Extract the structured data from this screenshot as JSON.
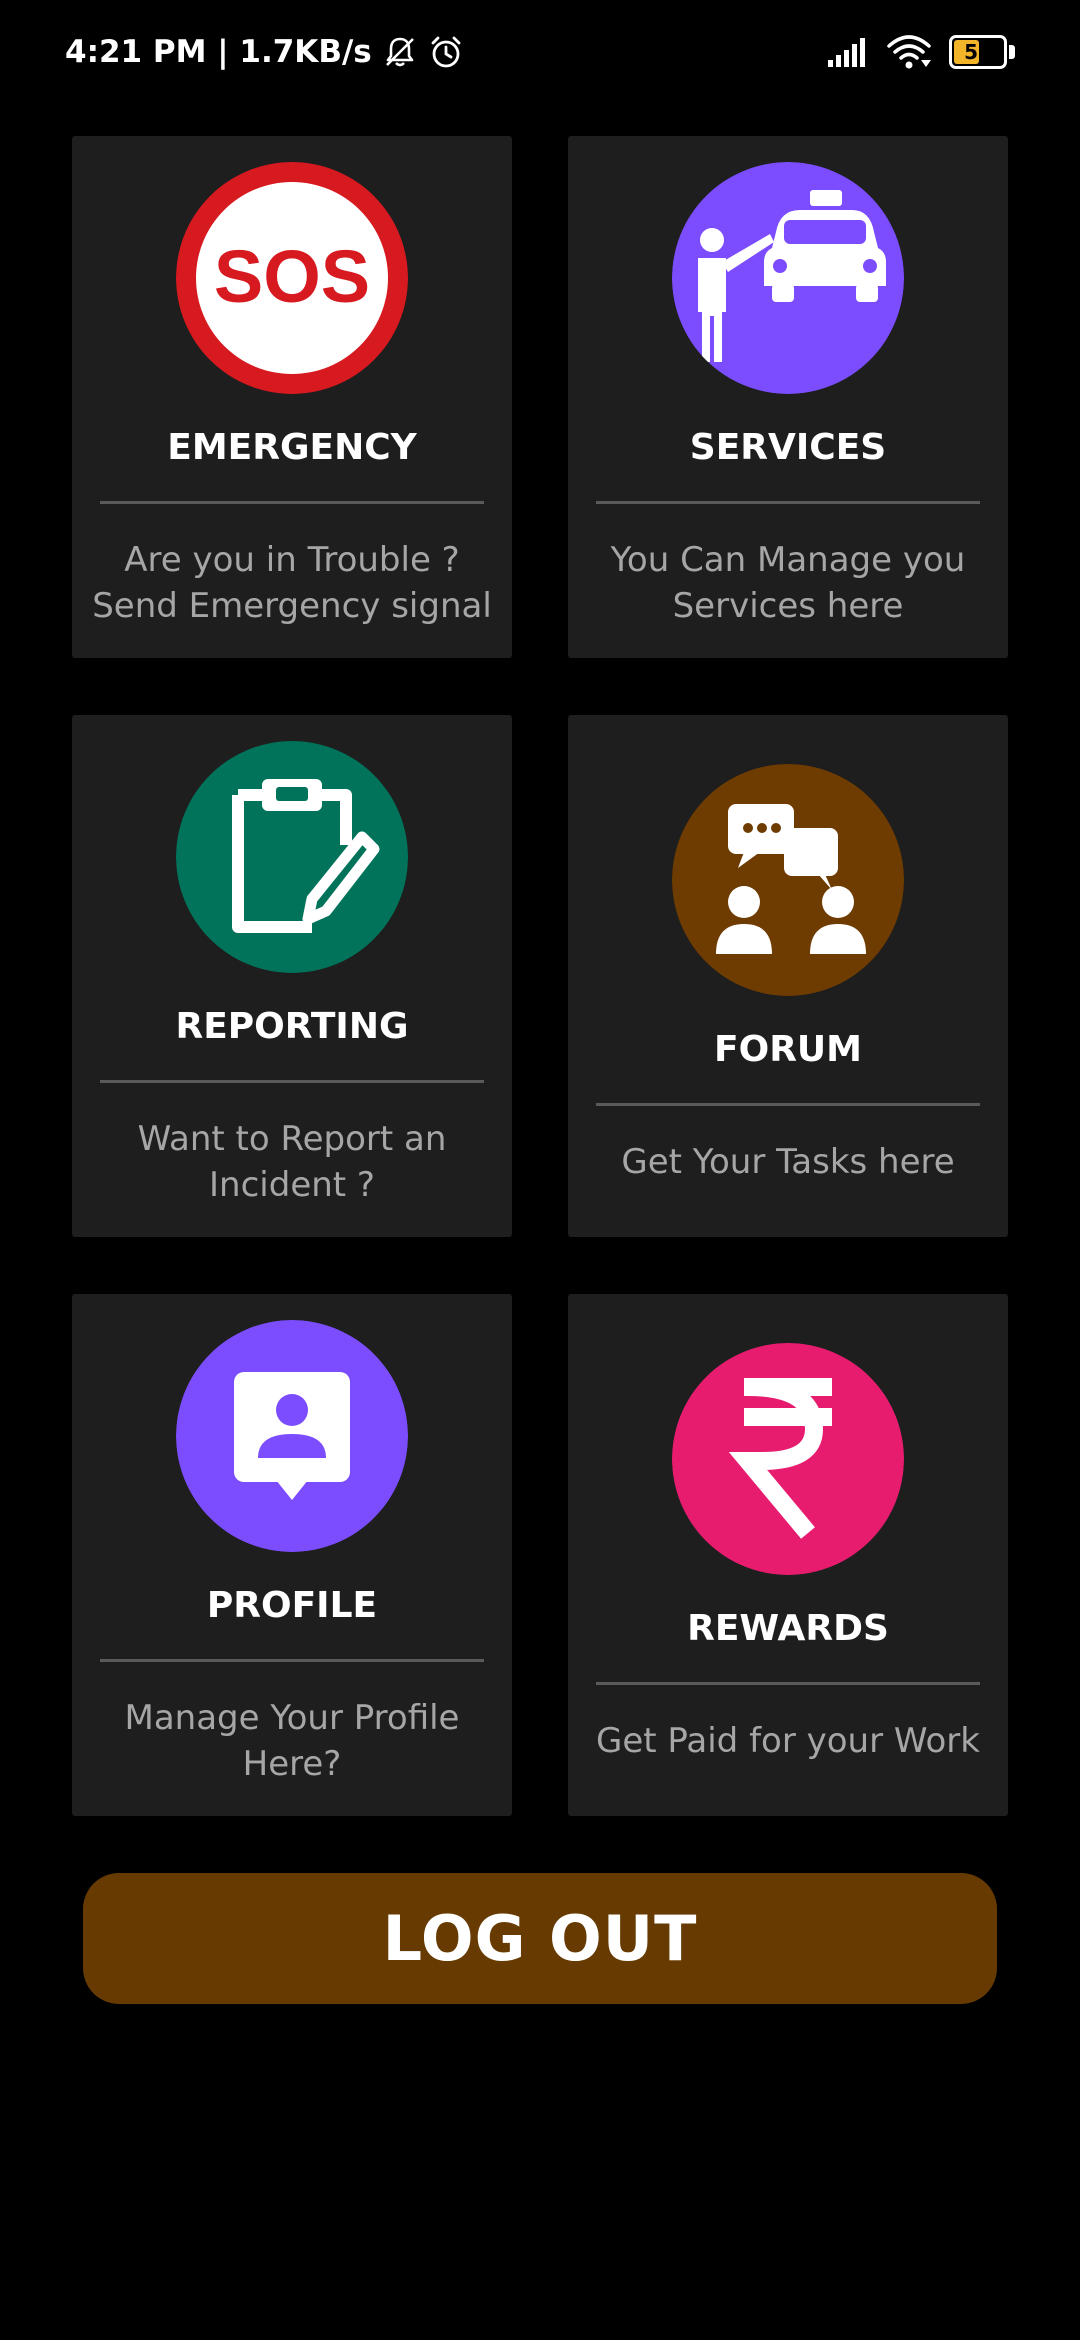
{
  "status_bar": {
    "time_speed": "4:21 PM | 1.7KB/s",
    "icons": [
      "mute-bell-icon",
      "alarm-clock-icon",
      "signal-icon",
      "wifi-icon",
      "battery-icon"
    ],
    "battery_level": "52",
    "battery_fraction": 0.52,
    "battery_color": "#f2b52a"
  },
  "cards": [
    {
      "icon": "sos-icon",
      "icon_text": "SOS",
      "icon_color": "#d71920",
      "title": "EMERGENCY",
      "desc_line1": "Are you in Trouble ?",
      "desc_line2": "Send Emergency signal"
    },
    {
      "icon": "taxi-services-icon",
      "icon_color": "#7c4dff",
      "title": "SERVICES",
      "desc_line1": "You Can Manage you",
      "desc_line2": "Services here"
    },
    {
      "icon": "clipboard-report-icon",
      "icon_color": "#00735a",
      "title": "REPORTING",
      "desc_line1": "Want to Report an",
      "desc_line2": "Incident ?"
    },
    {
      "icon": "forum-chat-icon",
      "icon_color": "#6e3b00",
      "title": "FORUM",
      "desc_line1": "Get Your Tasks here"
    },
    {
      "icon": "profile-icon",
      "icon_color": "#7c4dff",
      "title": "PROFILE",
      "desc_line1": "Manage Your Profile",
      "desc_line2": "Here?"
    },
    {
      "icon": "rupee-icon",
      "icon_color": "#e81c6f",
      "title": "REWARDS",
      "desc_line1": "Get Paid for your Work"
    }
  ],
  "logout": {
    "label": "LOG OUT",
    "color": "#663a00"
  }
}
